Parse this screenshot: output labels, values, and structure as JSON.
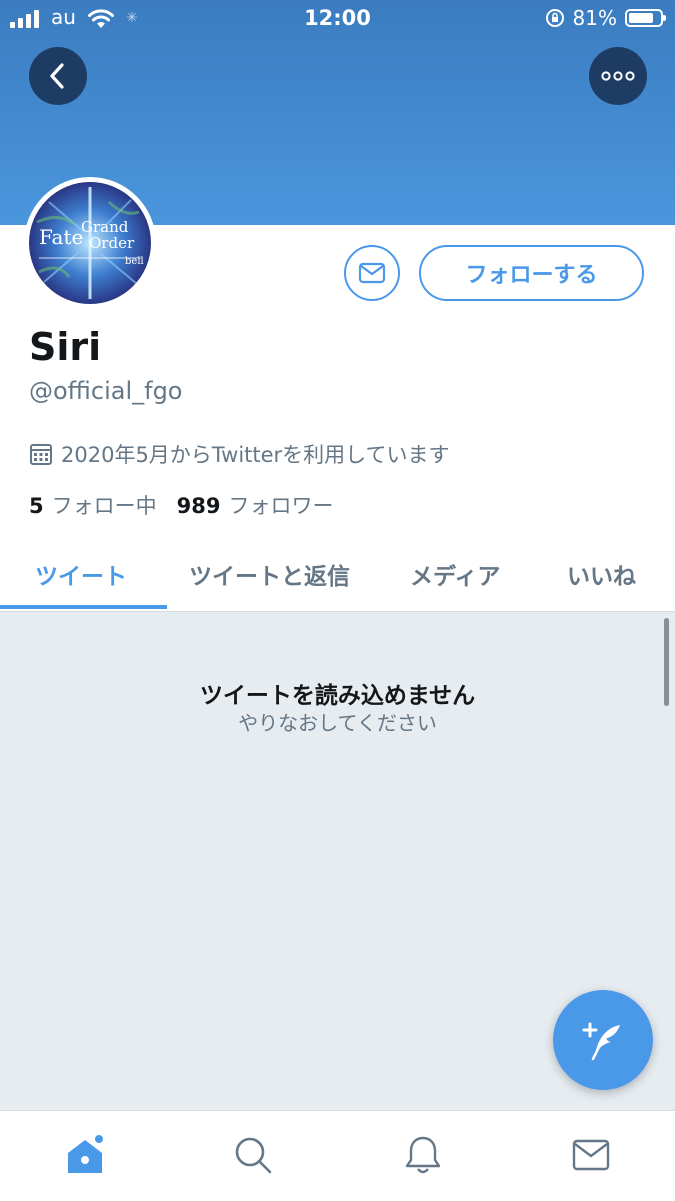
{
  "status_bar": {
    "carrier": "au",
    "time": "12:00",
    "battery": "81%",
    "battery_level": 0.81,
    "icons": [
      "signal-icon",
      "wifi-icon",
      "loading-icon",
      "rotation-lock-icon",
      "battery-icon"
    ]
  },
  "header": {
    "back_icon": "chevron-left-icon",
    "more_icon": "more-dots-icon",
    "banner_color": "#4a96dd"
  },
  "profile": {
    "avatar_text": {
      "line1": "Fate",
      "line2": "Grand",
      "line3": "Order",
      "line4": "bell"
    },
    "name": "Siri",
    "handle": "@official_fgo",
    "joined": "2020年5月からTwitterを利用しています",
    "following_count": "5",
    "following_label": "フォロー中",
    "followers_count": "989",
    "followers_label": "フォロワー",
    "follow_button": "フォローする",
    "message_icon": "envelope-icon"
  },
  "tabs": [
    {
      "label": "ツイート",
      "active": true
    },
    {
      "label": "ツイートと返信",
      "active": false
    },
    {
      "label": "メディア",
      "active": false
    },
    {
      "label": "いいね",
      "active": false
    }
  ],
  "content": {
    "error_title": "ツイートを読み込めません",
    "error_subtitle": "やりなおしてください"
  },
  "compose_icon": "compose-tweet-icon",
  "bottom_nav": [
    {
      "icon": "home-icon",
      "active": true
    },
    {
      "icon": "search-icon",
      "active": false
    },
    {
      "icon": "notifications-icon",
      "active": false
    },
    {
      "icon": "messages-icon",
      "active": false
    }
  ],
  "colors": {
    "accent": "#4a99e9",
    "text": "#14171a",
    "secondary": "#657786",
    "background": "#e6ecf0"
  }
}
